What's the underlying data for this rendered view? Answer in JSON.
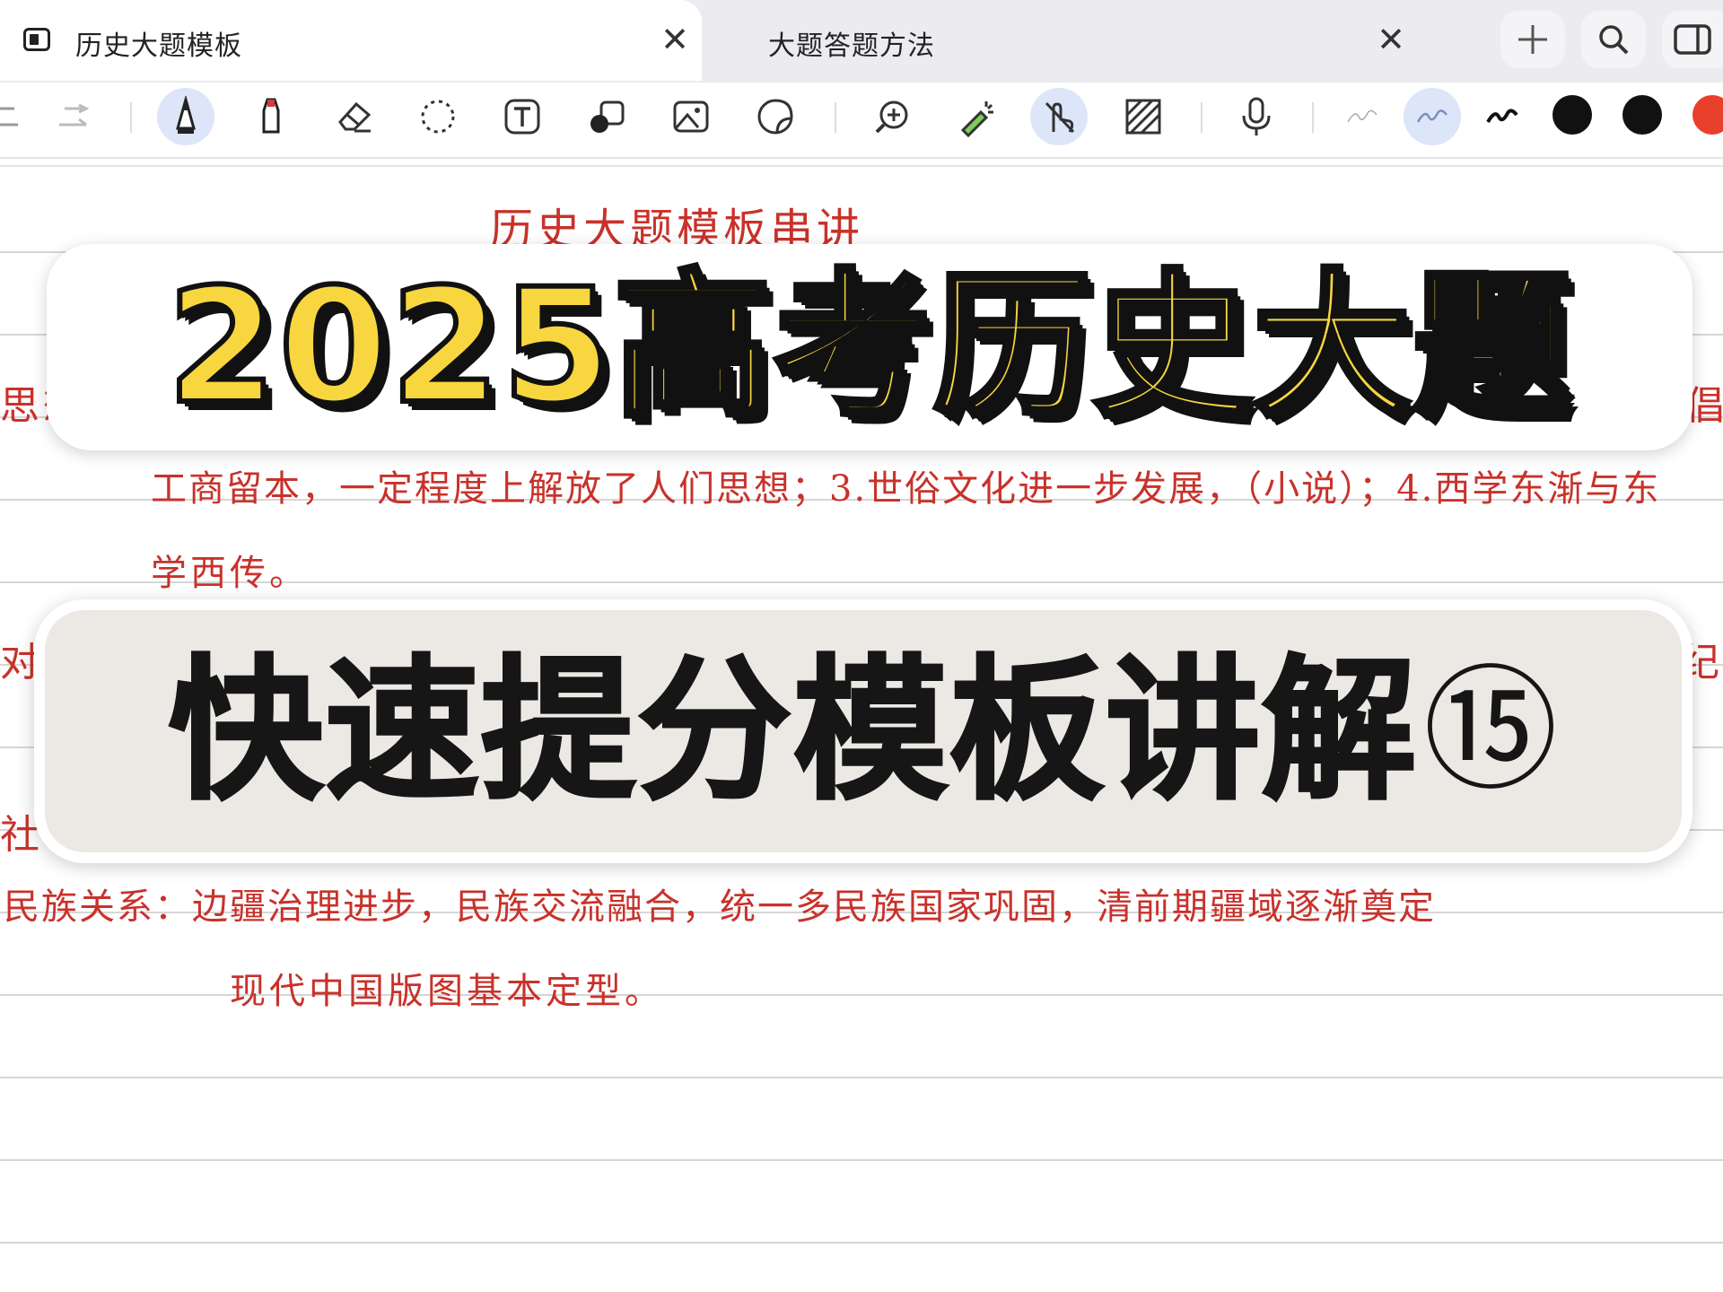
{
  "tabs": [
    {
      "label": "历史大题模板",
      "active": true
    },
    {
      "label": "大题答题方法",
      "active": false
    }
  ],
  "top_actions": [
    "add-icon",
    "search-icon",
    "sidebar-toggle-icon"
  ],
  "toolbar": {
    "tools": [
      "undo-icon",
      "redo-icon",
      "pen-icon",
      "marker-icon",
      "eraser-icon",
      "lasso-icon",
      "text-icon",
      "shapes-icon",
      "image-icon",
      "sticker-icon",
      "zoom-icon",
      "laser-pointer-icon",
      "touch-draw-icon",
      "pattern-icon",
      "microphone-icon",
      "stroke-thin-icon",
      "stroke-medium-icon",
      "stroke-thick-icon"
    ],
    "colors": [
      "#111111",
      "#111111",
      "#e8402a"
    ],
    "selected_tools": [
      "pen-icon",
      "touch-draw-icon",
      "stroke-medium-icon"
    ]
  },
  "notes": {
    "title": "历史大题模板串讲",
    "left_fragment_1": "思想",
    "right_fragment_1": "倡",
    "line_1": "工商留本，一定程度上解放了人们思想；3.世俗文化进一步发展，（小说）；4.西学东渐与东",
    "line_2": "学西传。",
    "left_fragment_2": "对外",
    "right_fragment_2": "纪",
    "left_fragment_3": "社",
    "line_3": "民族关系：边疆治理进步，民族交流融合，统一多民族国家巩固，清前期疆域逐渐奠定",
    "line_4": "现代中国版图基本定型。"
  },
  "banners": {
    "headline": "2025高考历史大题",
    "subline": "快速提分模板讲解",
    "episode": "⑮"
  },
  "accent_colors": {
    "headline_fill": "#f7d640",
    "handwriting": "#c8322b"
  }
}
